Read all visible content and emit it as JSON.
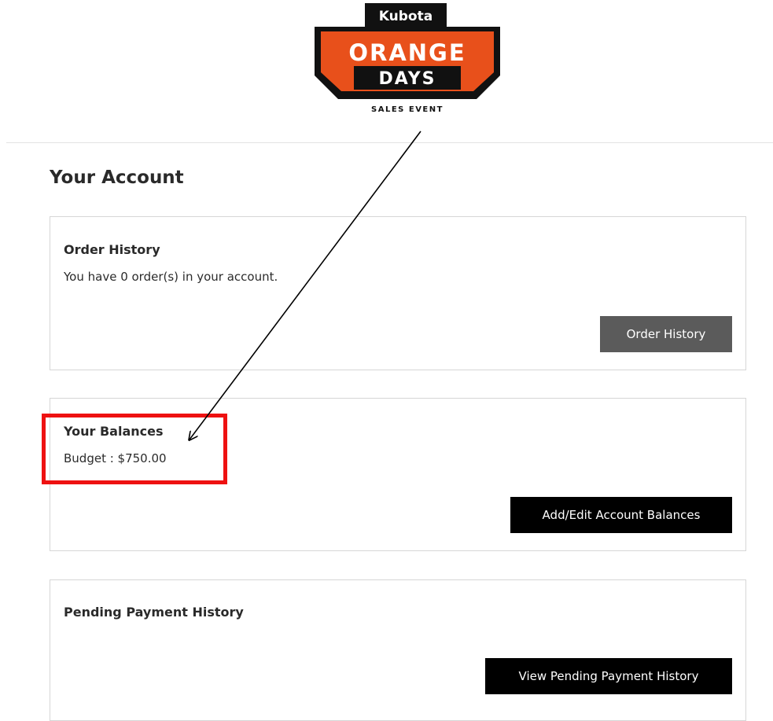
{
  "logo": {
    "brand": "Kubota",
    "line1": "ORANGE",
    "line2": "DAYS",
    "tagline": "SALES EVENT"
  },
  "page_title": "Your Account",
  "order_history": {
    "title": "Order History",
    "text": "You have 0 order(s) in your account.",
    "button": "Order History"
  },
  "balances": {
    "title": "Your Balances",
    "text": "Budget : $750.00",
    "button": "Add/Edit Account Balances"
  },
  "pending": {
    "title": "Pending Payment History",
    "button": "View Pending Payment History"
  },
  "colors": {
    "brand_orange": "#e8501b",
    "highlight_red": "#ee1111",
    "button_gray": "#5b5b5b",
    "button_black": "#000000"
  }
}
